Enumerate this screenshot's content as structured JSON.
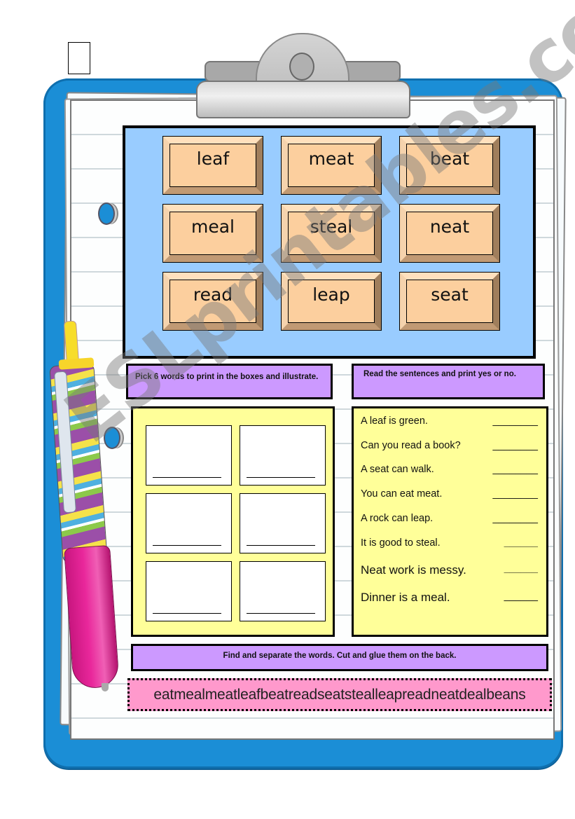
{
  "worksheet": {
    "word_tiles": [
      "leaf",
      "meat",
      "beat",
      "meal",
      "steal",
      "neat",
      "read",
      "leap",
      "seat"
    ],
    "instructions": {
      "pick_words": "Pick 6 words to print in the boxes and illustrate.",
      "read_sentences": "Read the sentences and print yes or no.",
      "find_separate": "Find and separate the words. Cut and glue them on the back."
    },
    "drawing_boxes_count": 6,
    "sentences": [
      {
        "text": "A leaf is green.",
        "blank": "________"
      },
      {
        "text": "Can you read a book?",
        "blank": "________"
      },
      {
        "text": "A seat can walk.",
        "blank": "________"
      },
      {
        "text": "You can eat meat.",
        "blank": "________"
      },
      {
        "text": "A rock can leap.",
        "blank": "________"
      },
      {
        "text": "It is good to steal.",
        "blank": "______"
      },
      {
        "text": "Neat work is messy.",
        "blank": "______"
      },
      {
        "text": "Dinner is a meal.",
        "blank": "______"
      }
    ],
    "word_strip": "eatmealmeatleafbeatreadseatstealleapreadneatdealbeans",
    "watermark": "ESLprintables.com"
  },
  "colors": {
    "board_blue": "#99ccff",
    "tile_peach": "#fccf9e",
    "instruction_purple": "#cc99ff",
    "panel_yellow": "#ffff99",
    "strip_pink": "#ff99cc",
    "clipboard_blue": "#1b8ed6"
  }
}
